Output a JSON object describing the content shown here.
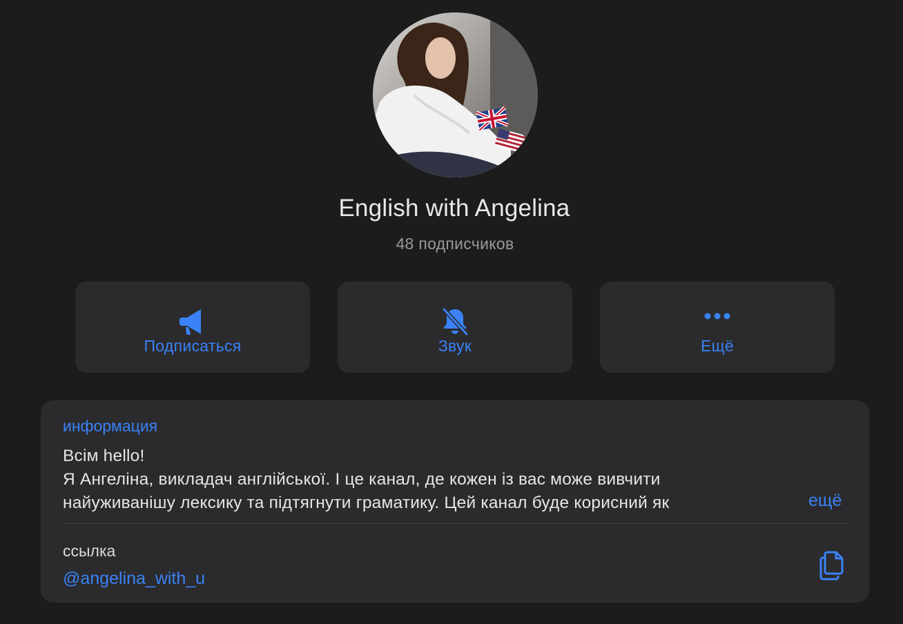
{
  "channel": {
    "title": "English with Angelina",
    "subscribers": "48 подписчиков"
  },
  "actions": [
    {
      "label": "Подписаться",
      "icon": "megaphone-icon"
    },
    {
      "label": "Звук",
      "icon": "bell-slash-icon"
    },
    {
      "label": "Ещё",
      "icon": "ellipsis-icon"
    }
  ],
  "info": {
    "label": "информация",
    "lines": [
      "Всім hello!",
      "Я Ангеліна, викладач англійської. І це канал, де кожен із вас може вивчити",
      "найуживанішу лексику та підтягнути граматику. Цей канал буде корисний як"
    ],
    "more_label": "ещё"
  },
  "link": {
    "label": "ссылка",
    "value": "@angelina_with_u",
    "copy_icon": "copy-icon"
  },
  "colors": {
    "background": "#1c1c1d",
    "card": "#2b2b2d",
    "accent": "#3a82f6",
    "secondary_text": "#9a9a9e"
  }
}
